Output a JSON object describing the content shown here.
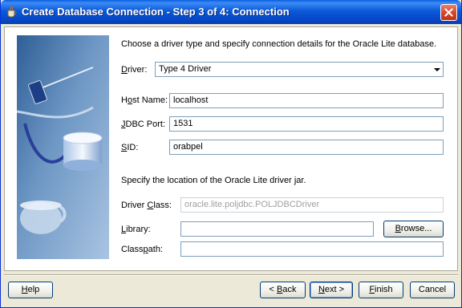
{
  "window": {
    "title": "Create Database Connection - Step 3 of 4: Connection"
  },
  "instructions": {
    "top": "Choose a driver type and specify connection details for the Oracle Lite database.",
    "driver_jar": "Specify the location of the Oracle Lite driver jar."
  },
  "fields": {
    "driver": {
      "label_mnemonic": "D",
      "label_rest": "river:",
      "value": "Type 4 Driver"
    },
    "host_name": {
      "label_prefix": "H",
      "label_mnemonic": "o",
      "label_rest": "st Name:",
      "value": "localhost"
    },
    "jdbc_port": {
      "label_mnemonic": "J",
      "label_rest": "DBC Port:",
      "value": "1531"
    },
    "sid": {
      "label_mnemonic": "S",
      "label_rest": "ID:",
      "value": "orabpel"
    },
    "driver_class": {
      "label_prefix": "Driver ",
      "label_mnemonic": "C",
      "label_rest": "lass:",
      "value": "oracle.lite.poljdbc.POLJDBCDriver"
    },
    "library": {
      "label_mnemonic": "L",
      "label_rest": "ibrary:",
      "value": ""
    },
    "classpath": {
      "label_prefix": "Class",
      "label_mnemonic": "p",
      "label_rest": "ath:",
      "value": ""
    }
  },
  "buttons": {
    "browse": {
      "mnemonic": "B",
      "rest": "rowse..."
    },
    "help": {
      "mnemonic": "H",
      "rest": "elp"
    },
    "back": {
      "prefix": "< ",
      "mnemonic": "B",
      "rest": "ack"
    },
    "next": {
      "mnemonic": "N",
      "rest": "ext >"
    },
    "finish": {
      "mnemonic": "F",
      "rest": "inish"
    },
    "cancel": {
      "label": "Cancel"
    }
  },
  "colors": {
    "titlebar": "#0B5AD9",
    "close": "#D2452A",
    "panel_image": "#5F88B8"
  }
}
